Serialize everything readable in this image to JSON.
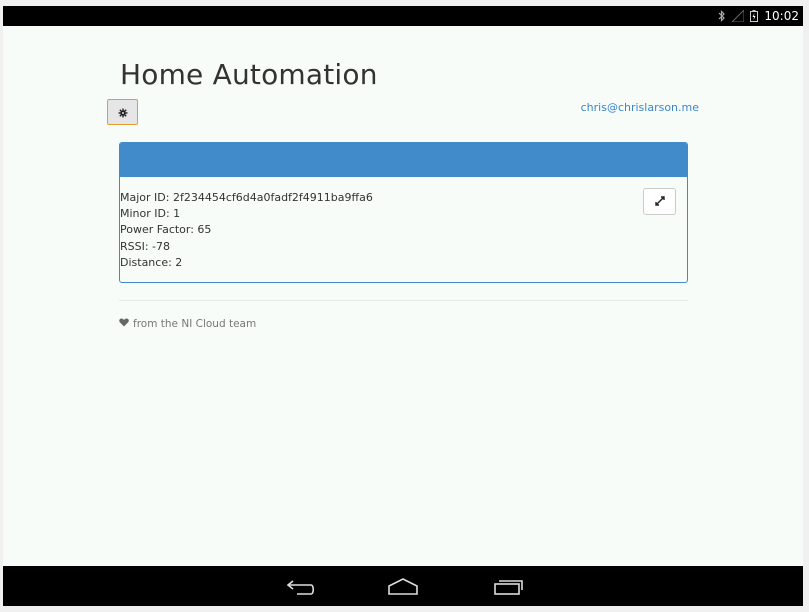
{
  "status_bar": {
    "time": "10:02",
    "icons": [
      "bluetooth-icon",
      "signal-icon",
      "battery-icon"
    ]
  },
  "page": {
    "title": "Home Automation",
    "user_email": "chris@chrislarson.me",
    "settings_icon": "gear-icon"
  },
  "device_panel": {
    "lines": [
      "Major ID: 2f234454cf6d4a0fadf2f4911ba9ffa6",
      "Minor ID: 1",
      "Power Factor: 65",
      "RSSI: -78",
      "Distance: 2"
    ],
    "expand_icon": "expand-icon"
  },
  "footer": {
    "text": "from the NI Cloud team",
    "icon": "heart-icon"
  },
  "nav_bar": {
    "buttons": [
      "back-icon",
      "home-icon",
      "recents-icon"
    ]
  },
  "colors": {
    "accent": "#428bca",
    "link": "#3a86c8",
    "background": "#f8fcf9"
  }
}
